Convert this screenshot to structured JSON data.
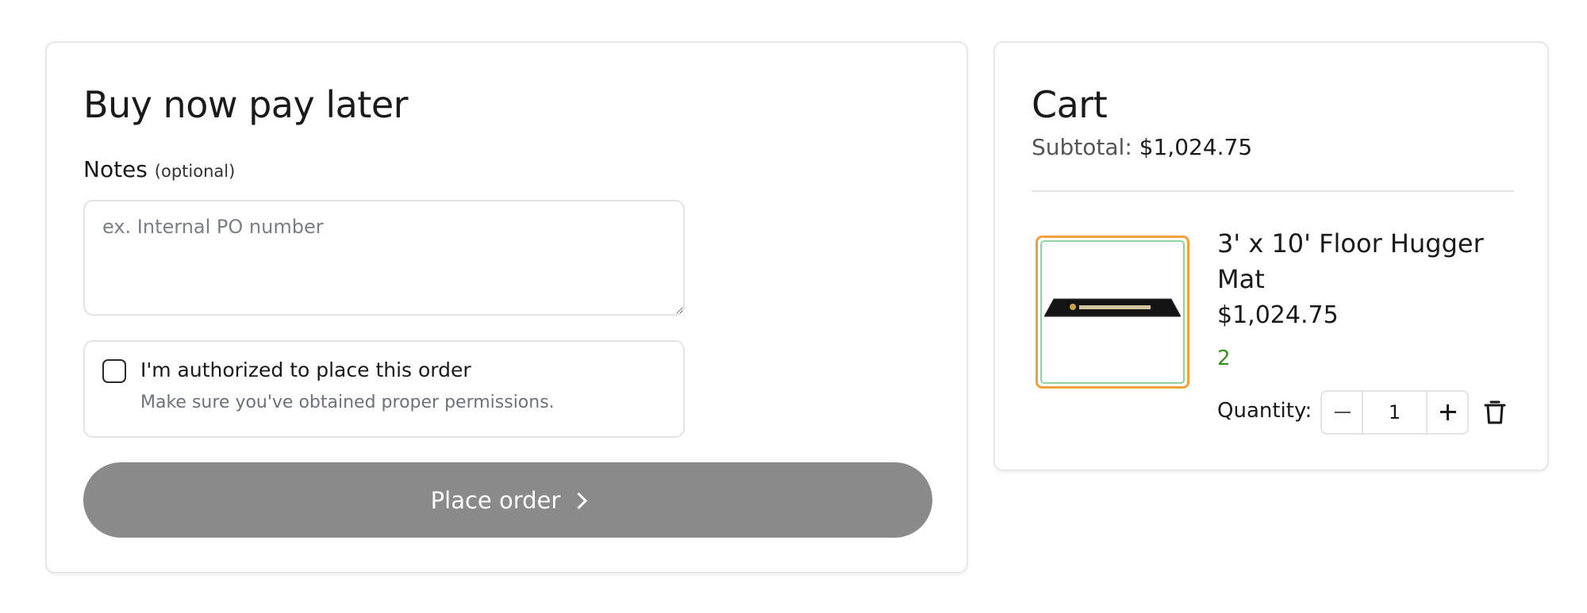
{
  "checkout": {
    "title": "Buy now pay later",
    "notes_label": "Notes",
    "notes_optional": "(optional)",
    "notes_placeholder": "ex. Internal PO number",
    "notes_value": "",
    "auth_title": "I'm authorized to place this order",
    "auth_subtitle": "Make sure you've obtained proper permissions.",
    "place_order_label": "Place order",
    "button_color": "#8a8a8a"
  },
  "cart": {
    "title": "Cart",
    "subtotal_label": "Subtotal:",
    "subtotal_value": "$1,024.75",
    "items": [
      {
        "name": "3' x 10' Floor Hugger Mat",
        "price": "$1,024.75",
        "badge": "2",
        "badge_color": "#3c8a25",
        "quantity_label": "Quantity:",
        "quantity": "1",
        "thumbnail_icon": "floor-mat-image"
      }
    ]
  },
  "icons": {
    "place_order": "chevron-right-icon",
    "minus": "minus-icon",
    "plus": "plus-icon",
    "delete": "trash-icon"
  }
}
